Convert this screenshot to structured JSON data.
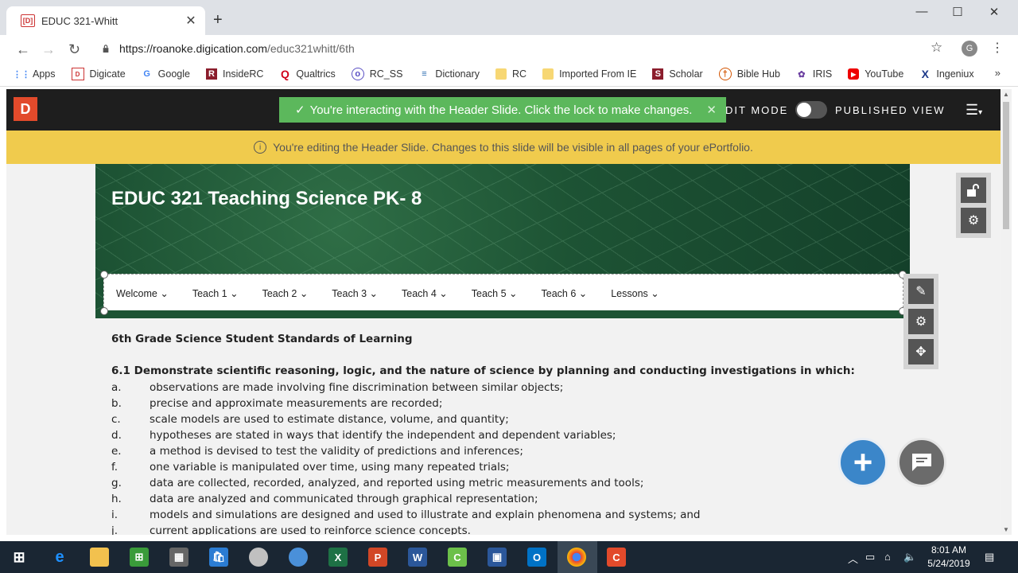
{
  "browser": {
    "tab_title": "EDUC 321-Whitt",
    "tab_favicon": "[D]",
    "new_tab": "+",
    "url_domain": "https://roanoke.digication.com",
    "url_path": "/educ321whitt/6th",
    "profile_initial": "G",
    "bookmarks": [
      {
        "label": "Apps",
        "icon": "apps-grid-icon"
      },
      {
        "label": "Digicate",
        "icon": "digication-icon"
      },
      {
        "label": "Google",
        "icon": "google-icon"
      },
      {
        "label": "InsideRC",
        "icon": "insiderc-icon"
      },
      {
        "label": "Qualtrics",
        "icon": "qualtrics-icon"
      },
      {
        "label": "RC_SS",
        "icon": "rcss-icon"
      },
      {
        "label": "Dictionary",
        "icon": "dictionary-icon"
      },
      {
        "label": "RC",
        "icon": "folder-icon"
      },
      {
        "label": "Imported From IE",
        "icon": "folder-icon"
      },
      {
        "label": "Scholar",
        "icon": "scholar-icon"
      },
      {
        "label": "Bible Hub",
        "icon": "biblehub-icon"
      },
      {
        "label": "IRIS",
        "icon": "iris-icon"
      },
      {
        "label": "YouTube",
        "icon": "youtube-icon"
      },
      {
        "label": "Ingeniux",
        "icon": "ingeniux-icon"
      }
    ],
    "bookmarks_more": "»"
  },
  "app": {
    "logo": "D",
    "toast": "You're interacting with the Header Slide. Click the lock to make changes.",
    "edit_mode_label": "DIT MODE",
    "published_view_label": "PUBLISHED VIEW",
    "notice": "You're editing the Header Slide. Changes to this slide will be visible in all pages of your ePortfolio.",
    "header_title": "EDUC 321 Teaching Science PK- 8",
    "nav": [
      "Welcome",
      "Teach 1",
      "Teach 2",
      "Teach 3",
      "Teach 4",
      "Teach 5",
      "Teach 6",
      "Lessons"
    ],
    "colors": {
      "brand": "#e24a2b",
      "toast": "#5cb85c",
      "notice": "#f0cb4d",
      "add_button": "#3b86c9"
    }
  },
  "content": {
    "heading": "6th Grade Science Student Standards of Learning",
    "standard": "6.1    Demonstrate scientific reasoning, logic, and the nature of science by planning and conducting investigations in which:",
    "items": [
      {
        "letter": "a.",
        "text": "observations are made involving fine discrimination between similar objects;"
      },
      {
        "letter": "b.",
        "text": "precise and approximate measurements are recorded;"
      },
      {
        "letter": "c.",
        "text": "scale models are used to estimate distance, volume, and quantity;"
      },
      {
        "letter": "d.",
        "text": "hypotheses are stated in ways that identify the independent and dependent variables;"
      },
      {
        "letter": "e.",
        "text": "a method is devised to test the validity of predictions and inferences;"
      },
      {
        "letter": "f.",
        "text": "one variable is manipulated over time, using many repeated trials;"
      },
      {
        "letter": "g.",
        "text": "data are collected, recorded, analyzed, and reported using metric measurements and tools;"
      },
      {
        "letter": "h.",
        "text": "data are analyzed and communicated through graphical representation;"
      },
      {
        "letter": "i.",
        "text": "models and simulations are designed and used to illustrate and explain phenomena and systems; and"
      },
      {
        "letter": "j.",
        "text": "current applications are used to reinforce science concepts."
      }
    ]
  },
  "taskbar": {
    "time": "8:01 AM",
    "date": "5/24/2019"
  }
}
